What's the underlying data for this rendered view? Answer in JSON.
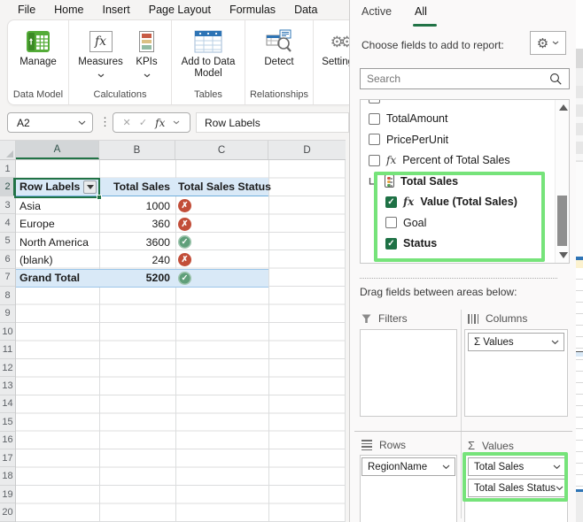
{
  "ribbon": {
    "tabs": [
      "File",
      "Home",
      "Insert",
      "Page Layout",
      "Formulas",
      "Data"
    ],
    "buttons": {
      "manage": "Manage",
      "measures": "Measures",
      "kpis": "KPIs",
      "add_to_data_model": "Add to Data Model",
      "detect": "Detect",
      "settings": "Settings"
    },
    "groups": [
      "Data Model",
      "Calculations",
      "Tables",
      "Relationships"
    ]
  },
  "formula_bar": {
    "name_box": "A2",
    "formula": "Row Labels"
  },
  "grid": {
    "columns": [
      "A",
      "B",
      "C",
      "D"
    ],
    "row_numbers": [
      "1",
      "2",
      "3",
      "4",
      "5",
      "6",
      "7",
      "8",
      "9",
      "10",
      "11",
      "12",
      "13",
      "14",
      "15",
      "16",
      "17",
      "18",
      "19",
      "20"
    ],
    "selected_cell": "A2",
    "selected_row": "2",
    "selected_col": "A",
    "pivot": {
      "headers": [
        "Row Labels",
        "Total Sales",
        "Total Sales Status"
      ],
      "rows": [
        {
          "label": "Asia",
          "value": "1000",
          "status": "bad"
        },
        {
          "label": "Europe",
          "value": "360",
          "status": "bad"
        },
        {
          "label": "North America",
          "value": "3600",
          "status": "good"
        },
        {
          "label": "(blank)",
          "value": "240",
          "status": "bad"
        },
        {
          "label": "Grand Total",
          "value": "5200",
          "status": "good"
        }
      ],
      "status_icons": {
        "bad": "x-circle-icon",
        "good": "check-circle-icon"
      }
    }
  },
  "panel": {
    "tabs": [
      {
        "label": "Active",
        "active": false
      },
      {
        "label": "All",
        "active": true
      }
    ],
    "choose_label": "Choose fields to add to report:",
    "search_placeholder": "Search",
    "fields": [
      {
        "label": "TotalAmount",
        "checked": false
      },
      {
        "label": "PricePerUnit",
        "checked": false
      },
      {
        "label": "Percent of Total Sales",
        "checked": false,
        "fx": true
      },
      {
        "label": "Total Sales",
        "group": true
      },
      {
        "label": "Value (Total Sales)",
        "checked": true,
        "fx": true
      },
      {
        "label": "Goal",
        "checked": false
      },
      {
        "label": "Status",
        "checked": true
      }
    ],
    "drag_label": "Drag fields between areas below:",
    "areas": {
      "filters": {
        "label": "Filters",
        "items": []
      },
      "columns": {
        "label": "Columns",
        "items": [
          "Σ Values"
        ]
      },
      "rows": {
        "label": "Rows",
        "items": [
          "RegionName"
        ]
      },
      "values": {
        "label": "Values",
        "items": [
          "Total Sales",
          "Total Sales Status"
        ]
      }
    }
  },
  "icons": {
    "fx_glyph": "fx",
    "sigma": "Σ",
    "gear": "⚙",
    "grip": "⋮",
    "cancel": "✕",
    "check": "✓",
    "cross": "✗"
  },
  "colors": {
    "excel_green": "#217346",
    "annotation_green": "#76E37A",
    "pivot_fill": "#D9E9F7",
    "pivot_border_blue": "#6FAEDC",
    "status_bad": "#C24E39",
    "status_good": "#5F9F7A",
    "checked_green": "#1E7145"
  }
}
